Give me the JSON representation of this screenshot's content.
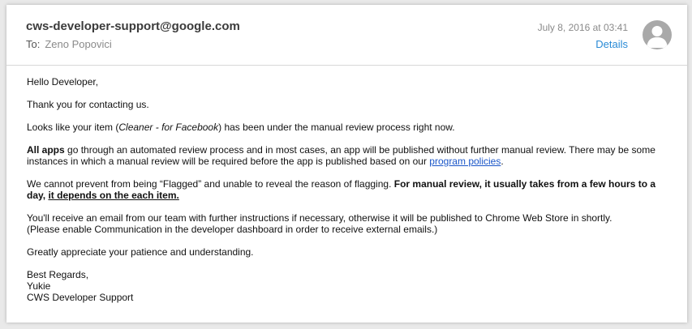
{
  "email": {
    "sender": "cws-developer-support@google.com",
    "to_label": "To:",
    "recipient": "Zeno Popovici",
    "date": "July 8, 2016 at 03:41",
    "details_label": "Details"
  },
  "body": {
    "greeting": "Hello Developer,",
    "thanks": "Thank you for contacting us.",
    "p1": {
      "before": "Looks like your item (",
      "item": "Cleaner - for Facebook",
      "after": ") has been under the manual review process right now."
    },
    "p2": {
      "bold": "All apps",
      "text": " go through an automated review process and in most cases, an app will be published without further manual review. There may be some instances in which a manual review will be required before the app is published based on our ",
      "link": "program policies",
      "end": "."
    },
    "p3": {
      "text": "We cannot prevent from being “Flagged” and unable to reveal the reason of flagging. ",
      "bold": "For manual review, it usually takes from a few hours to a day, ",
      "bold_underline": "it depends on the each item."
    },
    "p4": {
      "line1": "You'll receive an email from our team with further instructions if necessary, otherwise it will be published to Chrome Web Store in shortly.",
      "line2": "(Please enable Communication in the developer dashboard in order to receive external emails.)"
    },
    "appreciation": "Greatly appreciate your patience and understanding.",
    "signature": {
      "closing": "Best Regards,",
      "name": "Yukie",
      "team": "CWS Developer Support"
    }
  }
}
